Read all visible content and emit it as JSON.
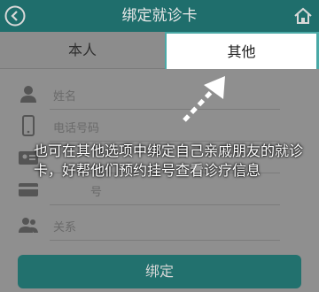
{
  "header": {
    "title": "绑定就诊卡",
    "back_icon": "chevron-left-circle-icon",
    "home_icon": "home-icon"
  },
  "tabs": [
    {
      "label": "本人",
      "selected": false
    },
    {
      "label": "其他",
      "selected": true
    }
  ],
  "form": {
    "fields": [
      {
        "icon": "person-icon",
        "label": "姓名"
      },
      {
        "icon": "phone-icon",
        "label": "电话号码"
      },
      {
        "icon": "id-card-icon",
        "label": ""
      },
      {
        "icon": "card-icon",
        "label": "号"
      },
      {
        "icon": "people-icon",
        "label": "关系"
      }
    ]
  },
  "annotation": {
    "text": "也可在其他选项中绑定自己亲戚朋友的就诊卡，好帮他们预约挂号查看诊疗信息"
  },
  "bind_button": {
    "label": "绑定"
  },
  "colors": {
    "header_bg": "#1f6e6c",
    "accent": "#4aa9a6",
    "overlay_bg": "#8f8f8f"
  }
}
